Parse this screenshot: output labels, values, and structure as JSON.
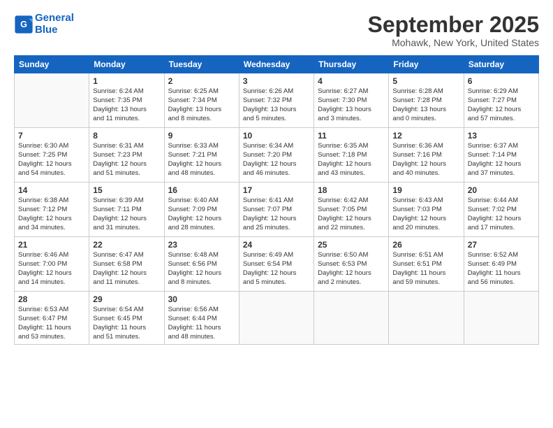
{
  "header": {
    "logo_line1": "General",
    "logo_line2": "Blue",
    "month": "September 2025",
    "location": "Mohawk, New York, United States"
  },
  "weekdays": [
    "Sunday",
    "Monday",
    "Tuesday",
    "Wednesday",
    "Thursday",
    "Friday",
    "Saturday"
  ],
  "weeks": [
    [
      {
        "day": "",
        "info": ""
      },
      {
        "day": "1",
        "info": "Sunrise: 6:24 AM\nSunset: 7:35 PM\nDaylight: 13 hours\nand 11 minutes."
      },
      {
        "day": "2",
        "info": "Sunrise: 6:25 AM\nSunset: 7:34 PM\nDaylight: 13 hours\nand 8 minutes."
      },
      {
        "day": "3",
        "info": "Sunrise: 6:26 AM\nSunset: 7:32 PM\nDaylight: 13 hours\nand 5 minutes."
      },
      {
        "day": "4",
        "info": "Sunrise: 6:27 AM\nSunset: 7:30 PM\nDaylight: 13 hours\nand 3 minutes."
      },
      {
        "day": "5",
        "info": "Sunrise: 6:28 AM\nSunset: 7:28 PM\nDaylight: 13 hours\nand 0 minutes."
      },
      {
        "day": "6",
        "info": "Sunrise: 6:29 AM\nSunset: 7:27 PM\nDaylight: 12 hours\nand 57 minutes."
      }
    ],
    [
      {
        "day": "7",
        "info": "Sunrise: 6:30 AM\nSunset: 7:25 PM\nDaylight: 12 hours\nand 54 minutes."
      },
      {
        "day": "8",
        "info": "Sunrise: 6:31 AM\nSunset: 7:23 PM\nDaylight: 12 hours\nand 51 minutes."
      },
      {
        "day": "9",
        "info": "Sunrise: 6:33 AM\nSunset: 7:21 PM\nDaylight: 12 hours\nand 48 minutes."
      },
      {
        "day": "10",
        "info": "Sunrise: 6:34 AM\nSunset: 7:20 PM\nDaylight: 12 hours\nand 46 minutes."
      },
      {
        "day": "11",
        "info": "Sunrise: 6:35 AM\nSunset: 7:18 PM\nDaylight: 12 hours\nand 43 minutes."
      },
      {
        "day": "12",
        "info": "Sunrise: 6:36 AM\nSunset: 7:16 PM\nDaylight: 12 hours\nand 40 minutes."
      },
      {
        "day": "13",
        "info": "Sunrise: 6:37 AM\nSunset: 7:14 PM\nDaylight: 12 hours\nand 37 minutes."
      }
    ],
    [
      {
        "day": "14",
        "info": "Sunrise: 6:38 AM\nSunset: 7:12 PM\nDaylight: 12 hours\nand 34 minutes."
      },
      {
        "day": "15",
        "info": "Sunrise: 6:39 AM\nSunset: 7:11 PM\nDaylight: 12 hours\nand 31 minutes."
      },
      {
        "day": "16",
        "info": "Sunrise: 6:40 AM\nSunset: 7:09 PM\nDaylight: 12 hours\nand 28 minutes."
      },
      {
        "day": "17",
        "info": "Sunrise: 6:41 AM\nSunset: 7:07 PM\nDaylight: 12 hours\nand 25 minutes."
      },
      {
        "day": "18",
        "info": "Sunrise: 6:42 AM\nSunset: 7:05 PM\nDaylight: 12 hours\nand 22 minutes."
      },
      {
        "day": "19",
        "info": "Sunrise: 6:43 AM\nSunset: 7:03 PM\nDaylight: 12 hours\nand 20 minutes."
      },
      {
        "day": "20",
        "info": "Sunrise: 6:44 AM\nSunset: 7:02 PM\nDaylight: 12 hours\nand 17 minutes."
      }
    ],
    [
      {
        "day": "21",
        "info": "Sunrise: 6:46 AM\nSunset: 7:00 PM\nDaylight: 12 hours\nand 14 minutes."
      },
      {
        "day": "22",
        "info": "Sunrise: 6:47 AM\nSunset: 6:58 PM\nDaylight: 12 hours\nand 11 minutes."
      },
      {
        "day": "23",
        "info": "Sunrise: 6:48 AM\nSunset: 6:56 PM\nDaylight: 12 hours\nand 8 minutes."
      },
      {
        "day": "24",
        "info": "Sunrise: 6:49 AM\nSunset: 6:54 PM\nDaylight: 12 hours\nand 5 minutes."
      },
      {
        "day": "25",
        "info": "Sunrise: 6:50 AM\nSunset: 6:53 PM\nDaylight: 12 hours\nand 2 minutes."
      },
      {
        "day": "26",
        "info": "Sunrise: 6:51 AM\nSunset: 6:51 PM\nDaylight: 11 hours\nand 59 minutes."
      },
      {
        "day": "27",
        "info": "Sunrise: 6:52 AM\nSunset: 6:49 PM\nDaylight: 11 hours\nand 56 minutes."
      }
    ],
    [
      {
        "day": "28",
        "info": "Sunrise: 6:53 AM\nSunset: 6:47 PM\nDaylight: 11 hours\nand 53 minutes."
      },
      {
        "day": "29",
        "info": "Sunrise: 6:54 AM\nSunset: 6:45 PM\nDaylight: 11 hours\nand 51 minutes."
      },
      {
        "day": "30",
        "info": "Sunrise: 6:56 AM\nSunset: 6:44 PM\nDaylight: 11 hours\nand 48 minutes."
      },
      {
        "day": "",
        "info": ""
      },
      {
        "day": "",
        "info": ""
      },
      {
        "day": "",
        "info": ""
      },
      {
        "day": "",
        "info": ""
      }
    ]
  ]
}
